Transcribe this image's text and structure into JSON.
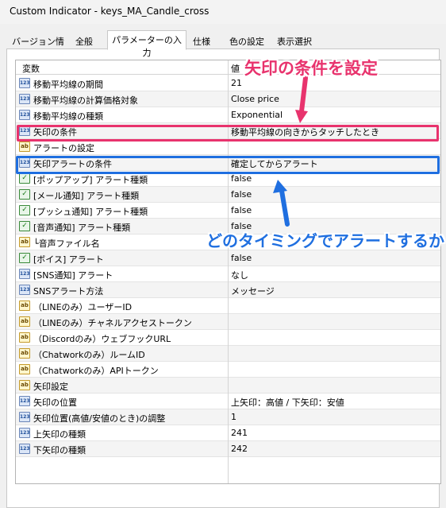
{
  "window": {
    "title": "Custom Indicator - keys_MA_Candle_cross"
  },
  "tabs": [
    {
      "label": "バージョン情報"
    },
    {
      "label": "全般"
    },
    {
      "label": "パラメーターの入力"
    },
    {
      "label": "仕様"
    },
    {
      "label": "色の設定"
    },
    {
      "label": "表示選択"
    }
  ],
  "grid": {
    "col_name": "変数",
    "col_value": "値",
    "rows": [
      {
        "icon": "123",
        "name": "移動平均線の期間",
        "value": "21"
      },
      {
        "icon": "123",
        "name": "移動平均線の計算価格対象",
        "value": "Close price"
      },
      {
        "icon": "123",
        "name": "移動平均線の種類",
        "value": "Exponential"
      },
      {
        "icon": "123",
        "name": "矢印の条件",
        "value": "移動平均線の向きからタッチしたとき"
      },
      {
        "icon": "ab",
        "name": "アラートの設定",
        "value": ""
      },
      {
        "icon": "123",
        "name": "矢印アラートの条件",
        "value": "確定してからアラート"
      },
      {
        "icon": "chk",
        "name": "[ポップアップ] アラート種類",
        "value": "false"
      },
      {
        "icon": "chk",
        "name": "[メール通知] アラート種類",
        "value": "false"
      },
      {
        "icon": "chk",
        "name": "[プッシュ通知] アラート種類",
        "value": "false"
      },
      {
        "icon": "chk",
        "name": "[音声通知] アラート種類",
        "value": "false"
      },
      {
        "icon": "ab",
        "name": "└音声ファイル名",
        "value": ""
      },
      {
        "icon": "chk",
        "name": "[ボイス] アラート",
        "value": "false"
      },
      {
        "icon": "123",
        "name": "[SNS通知] アラート",
        "value": "なし"
      },
      {
        "icon": "123",
        "name": "SNSアラート方法",
        "value": "メッセージ"
      },
      {
        "icon": "ab",
        "name": "（LINEのみ）ユーザーID",
        "value": ""
      },
      {
        "icon": "ab",
        "name": "（LINEのみ）チャネルアクセストークン",
        "value": ""
      },
      {
        "icon": "ab",
        "name": "（Discordのみ）ウェブフックURL",
        "value": ""
      },
      {
        "icon": "ab",
        "name": "（Chatworkのみ）ルームID",
        "value": ""
      },
      {
        "icon": "ab",
        "name": "（Chatworkのみ）APIトークン",
        "value": ""
      },
      {
        "icon": "ab",
        "name": "矢印設定",
        "value": ""
      },
      {
        "icon": "123",
        "name": "矢印の位置",
        "value": "上矢印：高値 / 下矢印：安値"
      },
      {
        "icon": "123",
        "name": "矢印位置(高値/安値のとき)の調整",
        "value": "1"
      },
      {
        "icon": "123",
        "name": "上矢印の種類",
        "value": "241"
      },
      {
        "icon": "123",
        "name": "下矢印の種類",
        "value": "242"
      }
    ]
  },
  "annotations": {
    "top_label": "矢印の条件を設定",
    "bottom_label": "どのタイミングでアラートするか"
  },
  "colors": {
    "highlight_pink": "#e8336d",
    "highlight_blue": "#1f6fe0"
  }
}
